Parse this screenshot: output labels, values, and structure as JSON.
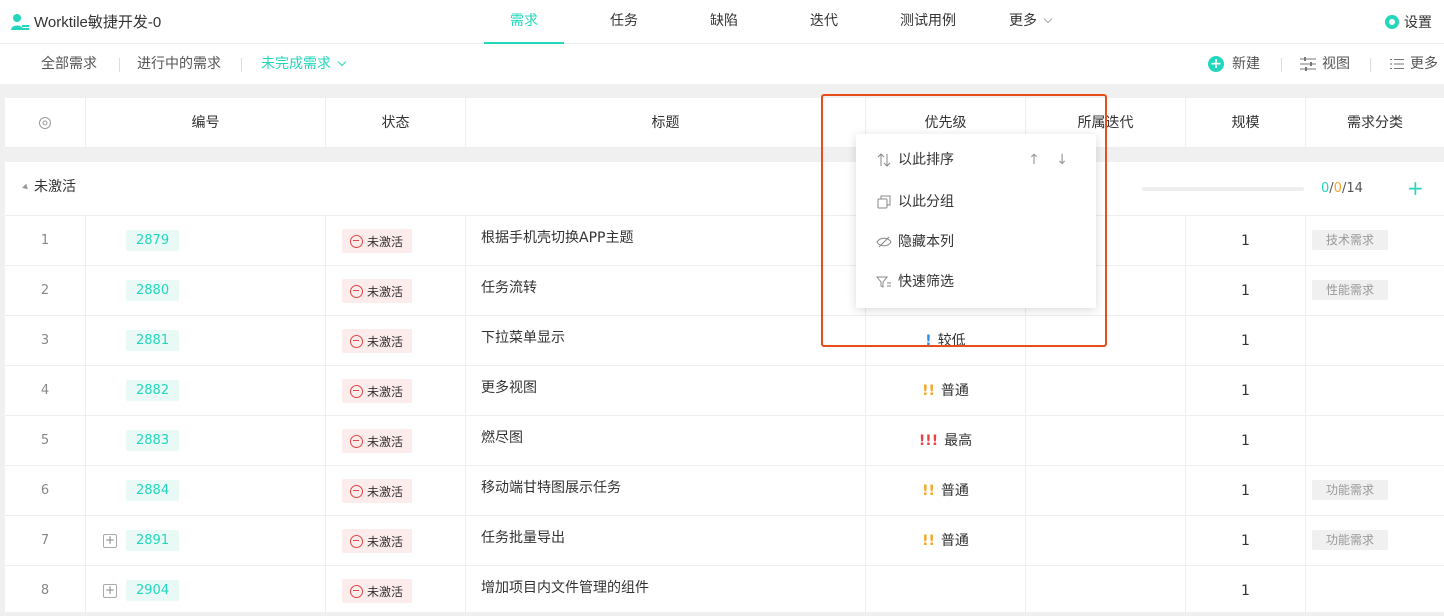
{
  "app": {
    "title": "Worktile敏捷开发-0"
  },
  "main_tabs": [
    {
      "label": "需求"
    },
    {
      "label": "任务"
    },
    {
      "label": "缺陷"
    },
    {
      "label": "迭代"
    },
    {
      "label": "测试用例"
    },
    {
      "label": "更多"
    }
  ],
  "settings_label": "设置",
  "sub_tabs": [
    {
      "label": "全部需求"
    },
    {
      "label": "进行中的需求"
    },
    {
      "label": "未完成需求"
    }
  ],
  "actions": {
    "new": "新建",
    "view": "视图",
    "more": "更多"
  },
  "columns": [
    "编号",
    "状态",
    "标题",
    "优先级",
    "所属迭代",
    "规模",
    "需求分类"
  ],
  "group": {
    "label": "未激活",
    "progress_done": "0",
    "progress_active": "0",
    "progress_total": "14",
    "progress_sep": "/",
    "add": "+"
  },
  "rows": [
    {
      "idx": "1",
      "id": "2879",
      "state": "未激活",
      "title": "根据手机壳切换APP主题",
      "priority": "",
      "priority_mark": "",
      "scale": "1",
      "category": "技术需求",
      "expandable": false
    },
    {
      "idx": "2",
      "id": "2880",
      "state": "未激活",
      "title": "任务流转",
      "priority": "",
      "priority_mark": "",
      "scale": "1",
      "category": "性能需求",
      "expandable": false
    },
    {
      "idx": "3",
      "id": "2881",
      "state": "未激活",
      "title": "下拉菜单显示",
      "priority": "较低",
      "priority_mark": "!",
      "scale": "1",
      "category": "",
      "expandable": false
    },
    {
      "idx": "4",
      "id": "2882",
      "state": "未激活",
      "title": "更多视图",
      "priority": "普通",
      "priority_mark": "!!",
      "scale": "1",
      "category": "",
      "expandable": false
    },
    {
      "idx": "5",
      "id": "2883",
      "state": "未激活",
      "title": "燃尽图",
      "priority": "最高",
      "priority_mark": "!!!",
      "scale": "1",
      "category": "",
      "expandable": false
    },
    {
      "idx": "6",
      "id": "2884",
      "state": "未激活",
      "title": "移动端甘特图展示任务",
      "priority": "普通",
      "priority_mark": "!!",
      "scale": "1",
      "category": "功能需求",
      "expandable": false
    },
    {
      "idx": "7",
      "id": "2891",
      "state": "未激活",
      "title": "任务批量导出",
      "priority": "普通",
      "priority_mark": "!!",
      "scale": "1",
      "category": "功能需求",
      "expandable": true
    },
    {
      "idx": "8",
      "id": "2904",
      "state": "未激活",
      "title": "增加项目内文件管理的组件",
      "priority": "",
      "priority_mark": "",
      "scale": "1",
      "category": "",
      "expandable": true
    }
  ],
  "column_menu": {
    "sort": "以此排序",
    "sort_arrows": "↑ ↓",
    "group": "以此分组",
    "hide": "隐藏本列",
    "filter": "快速筛选"
  },
  "colors": {
    "accent": "#22d7bb",
    "prio_low": "#2d8cf0",
    "prio_normal": "#f5a623",
    "prio_high": "#e54545",
    "highlight": "#e84e1c"
  }
}
